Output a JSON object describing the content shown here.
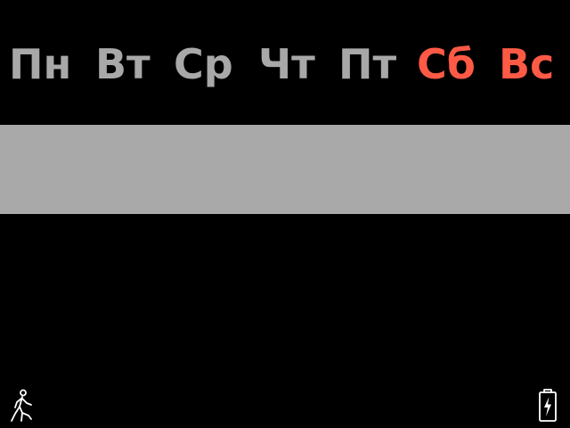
{
  "weekdays": [
    {
      "label": "Пн",
      "weekend": false
    },
    {
      "label": "Вт",
      "weekend": false
    },
    {
      "label": "Ср",
      "weekend": false
    },
    {
      "label": "Чт",
      "weekend": false
    },
    {
      "label": "Пт",
      "weekend": false
    },
    {
      "label": "Сб",
      "weekend": true
    },
    {
      "label": "Вс",
      "weekend": true
    }
  ],
  "colors": {
    "background": "#000000",
    "weekday_text": "#a8a8a8",
    "weekend_text": "#ff5a45",
    "selection_band": "#a9a9a9",
    "status_icon": "#ffffff"
  },
  "status_bar": {
    "left_icon": "walk-icon",
    "right_icon": "battery-charging-icon"
  }
}
